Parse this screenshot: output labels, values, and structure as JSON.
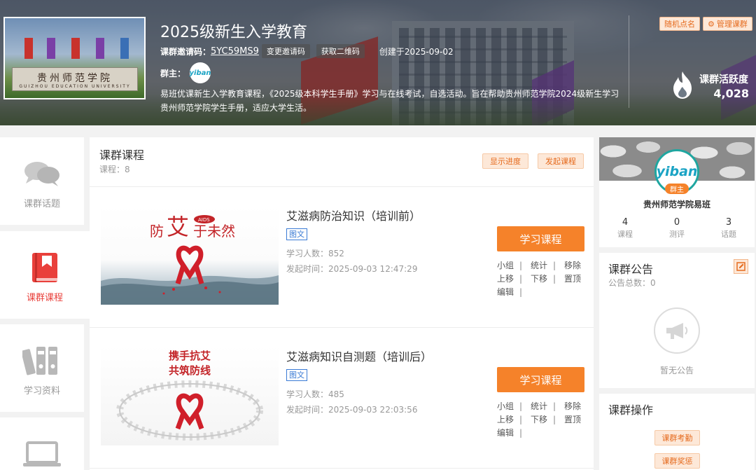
{
  "banner": {
    "thumbnail_text": "贵州师范学院",
    "thumbnail_subtext": "GUIZHOU  EDUCATION  UNIVERSITY",
    "title": "2025级新生入学教育",
    "invite_label": "课群邀请码：",
    "invite_code": "5YC59MS9",
    "change_code_label": "变更邀请码",
    "qr_label": "获取二维码",
    "created_label": "创建于2025-09-02",
    "owner_label": "群主：",
    "owner_avatar_text": "yiban",
    "description": "易班优课新生入学教育课程，《2025级本科学生手册》学习与在线考试，自选活动。旨在帮助贵州师范学院2024级新生学习贵州师范学院学生手册，适应大学生活。",
    "random_call_label": "随机点名",
    "manage_label": "管理课群",
    "activity_label": "课群活跃度",
    "activity_value": "4,028"
  },
  "nav": {
    "items": [
      {
        "label": "课群话题",
        "icon": "chat-bubbles-icon"
      },
      {
        "label": "课群课程",
        "icon": "book-icon"
      },
      {
        "label": "学习资料",
        "icon": "binders-icon"
      },
      {
        "label": "",
        "icon": "laptop-icon"
      }
    ]
  },
  "courses_section": {
    "title": "课群课程",
    "count_label": "课程：8",
    "show_progress_label": "显示进度",
    "start_course_label": "发起课程"
  },
  "courses": [
    {
      "title": "艾滋病防治知识（培训前）",
      "tag": "图文",
      "learners": "学习人数：852",
      "started": "发起时间：2025-09-03 12:47:29",
      "study_label": "学习课程",
      "image_text": "防艾于未然",
      "image_small": "AIDS",
      "ops": [
        "小组",
        "统计",
        "移除",
        "上移",
        "下移",
        "置顶",
        "编辑"
      ]
    },
    {
      "title": "艾滋病知识自测题（培训后）",
      "tag": "图文",
      "learners": "学习人数：485",
      "started": "发起时间：2025-09-03 22:03:56",
      "study_label": "学习课程",
      "image_line1": "携手抗艾",
      "image_line2": "共筑防线",
      "ops": [
        "小组",
        "统计",
        "移除",
        "上移",
        "下移",
        "置顶",
        "编辑"
      ]
    }
  ],
  "profile": {
    "avatar_text": "yiban",
    "badge": "群主",
    "name": "贵州师范学院易班",
    "stats": [
      {
        "value": "4",
        "label": "课程"
      },
      {
        "value": "0",
        "label": "测评"
      },
      {
        "value": "3",
        "label": "话题"
      }
    ]
  },
  "notice": {
    "title": "课群公告",
    "count_label": "公告总数：0",
    "empty_label": "暂无公告"
  },
  "group_ops": {
    "title": "课群操作",
    "attendance_label": "课群考勤",
    "reward_label": "课群奖惩"
  },
  "colors": {
    "accent_orange": "#f5822a",
    "active_red": "#e9403b",
    "tag_blue": "#3a7bd5"
  }
}
